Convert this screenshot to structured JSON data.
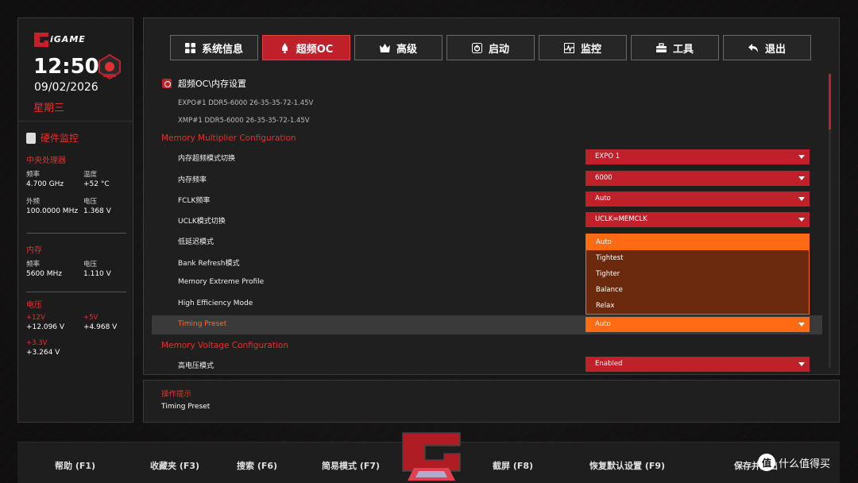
{
  "sidebar": {
    "brand": "iGAME",
    "time": "12:50",
    "date": "09/02/2026",
    "weekday": "星期三",
    "hw_title": "硬件监控",
    "cpu": {
      "heading": "中央处理器",
      "freq_label": "频率",
      "freq": "4.700 GHz",
      "temp_label": "温度",
      "temp": "+52 °C",
      "bclk_label": "外频",
      "bclk": "100.0000 MHz",
      "volt_label": "电压",
      "volt": "1.368 V"
    },
    "mem": {
      "heading": "内存",
      "freq_label": "频率",
      "freq": "5600 MHz",
      "volt_label": "电压",
      "volt": "1.110 V"
    },
    "power": {
      "heading": "电压",
      "v12_label": "+12V",
      "v12": "+12.096 V",
      "v5_label": "+5V",
      "v5": "+4.968 V",
      "v33_label": "+3.3V",
      "v33": "+3.264 V"
    }
  },
  "tabs": [
    {
      "label": "系统信息",
      "icon": "grid-icon"
    },
    {
      "label": "超频OC",
      "icon": "rocket-icon"
    },
    {
      "label": "高级",
      "icon": "crown-icon"
    },
    {
      "label": "启动",
      "icon": "power-icon"
    },
    {
      "label": "监控",
      "icon": "monitor-icon"
    },
    {
      "label": "工具",
      "icon": "toolbox-icon"
    },
    {
      "label": "退出",
      "icon": "back-arrow-icon"
    }
  ],
  "breadcrumb": "超频OC\\内存设置",
  "profiles": [
    "EXPO#1 DDR5-6000 26-35-35-72-1.45V",
    "XMP#1   DDR5-6000 26-35-35-72-1.45V"
  ],
  "sections": {
    "multiplier": "Memory Multiplier Configuration",
    "voltage": "Memory Voltage Configuration"
  },
  "settings": [
    {
      "label": "内存超频模式切换",
      "value": "EXPO 1"
    },
    {
      "label": "内存频率",
      "value": "6000"
    },
    {
      "label": "FCLK频率",
      "value": "Auto"
    },
    {
      "label": "UCLK模式切换",
      "value": "UCLK=MEMCLK"
    },
    {
      "label": "低延迟模式",
      "value": ""
    },
    {
      "label": "Bank Refresh模式",
      "value": ""
    },
    {
      "label": "Memory Extreme Profile",
      "value": ""
    },
    {
      "label": "High Efficiency Mode",
      "value": ""
    },
    {
      "label": "Timing Preset",
      "value": "Auto"
    },
    {
      "label": "高电压模式",
      "value": "Enabled"
    }
  ],
  "dropdown_options": [
    "Auto",
    "Tightest",
    "Tighter",
    "Balance",
    "Relax"
  ],
  "help": {
    "title": "操作提示",
    "text": "Timing Preset"
  },
  "footer": {
    "help": "帮助 (F1)",
    "favorites": "收藏夹 (F3)",
    "search": "搜索 (F6)",
    "easy_mode": "简易模式 (F7)",
    "screenshot": "截屏 (F8)",
    "defaults": "恢复默认设置 (F9)",
    "save_exit": "保存并退出",
    "watermark": "什么值得买",
    "watermark_badge": "值"
  },
  "colors": {
    "accent_red": "#c0202a",
    "accent_orange": "#ff6a14",
    "dropdown_bg": "#6b2a0e"
  }
}
